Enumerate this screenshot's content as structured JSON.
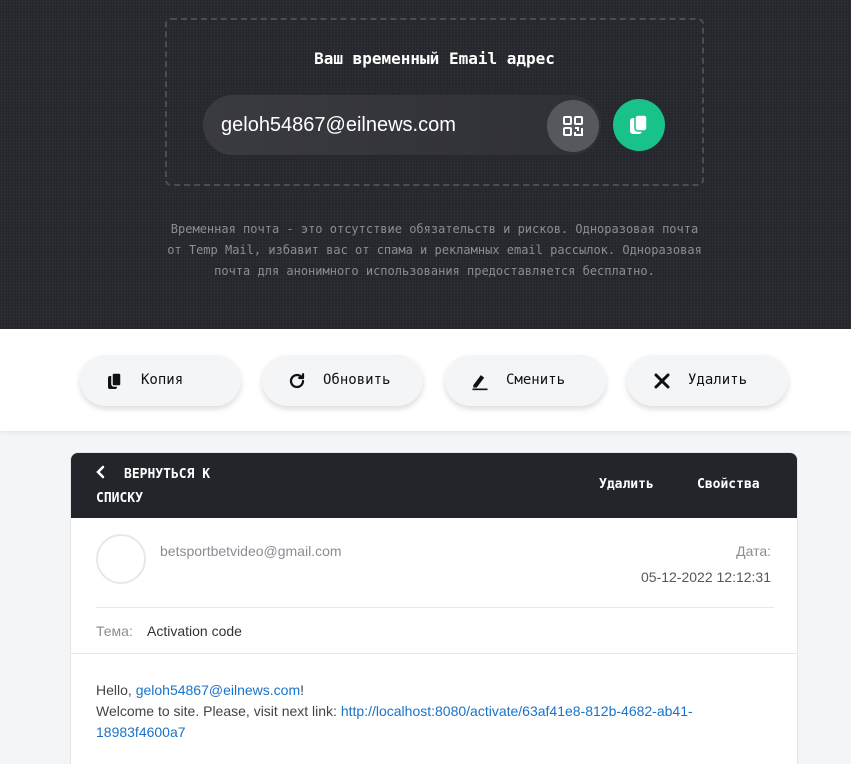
{
  "hero": {
    "title": "Ваш временный Email адрес",
    "email": "geloh54867@eilnews.com",
    "qr_icon": "qr-code-icon",
    "copy_icon": "copy-icon",
    "description": "Временная почта - это отсутствие обязательств и рисков. Одноразовая почта от Temp Mail, избавит вас от спама и рекламных email рассылок. Одноразовая почта для анонимного использования предоставляется бесплатно.",
    "accent_color": "#19c28a"
  },
  "actions": {
    "copy_label": "Копия",
    "refresh_label": "Обновить",
    "change_label": "Сменить",
    "delete_label": "Удалить"
  },
  "message": {
    "back_label": "ВЕРНУТЬСЯ К СПИСКУ",
    "delete_label": "Удалить",
    "properties_label": "Свойства",
    "sender": "betsportbetvideo@gmail.com",
    "date_label": "Дата:",
    "date_value": "05-12-2022 12:12:31",
    "subject_label": "Тема:",
    "subject_value": "Activation code",
    "greeting": "Hello, ",
    "greeting_email": "geloh54867@eilnews.com",
    "greeting_end": "!",
    "body_line": "Welcome to site. Please, visit next link: ",
    "activation_link": "http://localhost:8080/activate/63af41e8-812b-4682-ab41-18983f4600a7"
  }
}
